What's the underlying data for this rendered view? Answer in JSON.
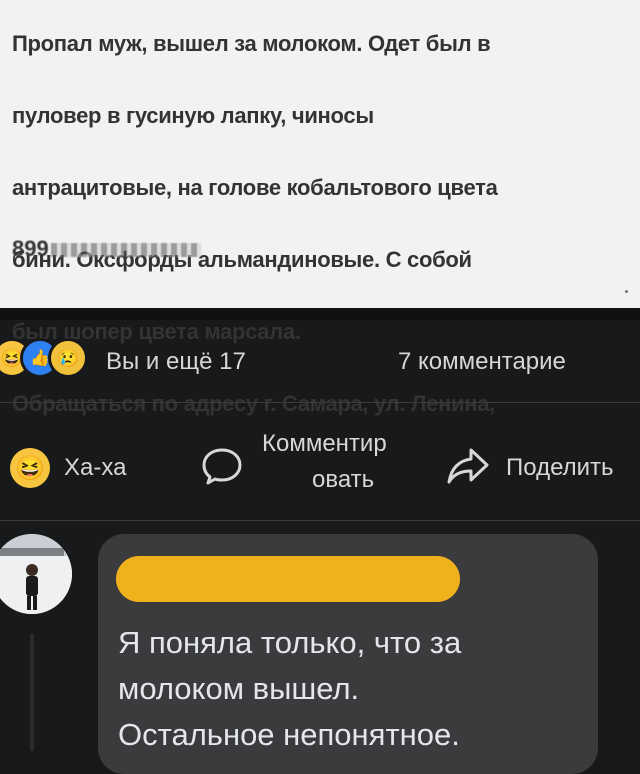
{
  "post": {
    "lines": [
      "Пропал муж, вышел за молоком. Одет был в",
      "пуловер в гусиную лапку, чиносы",
      "антрацитовые, на голове кобальтового цвета",
      "бини. Оксфорды альмандиновые. С собой",
      "был шопер цвета марсала.",
      "Обращаться по адресу г. Самара, ул. Ленина,"
    ],
    "phone": "899"
  },
  "reactions": {
    "icons": [
      "haha-icon",
      "like-icon",
      "sad-icon"
    ],
    "summary": "Вы и ещё 17",
    "comments_count": "7 комментарие"
  },
  "actions": {
    "haha_label": "Ха-ха",
    "comment_label_line1": "Комментир",
    "comment_label_line2": "овать",
    "share_label": "Поделить"
  },
  "comment": {
    "author_redacted": true,
    "text_lines": [
      "Я поняла только, что за",
      "молоком вышел.",
      "Остальное непонятное."
    ]
  },
  "colors": {
    "background": "#18191a",
    "bubble": "#3a3b3c",
    "redaction": "#f0b21c",
    "like": "#2e81f2",
    "haha": "#f7c53f"
  }
}
